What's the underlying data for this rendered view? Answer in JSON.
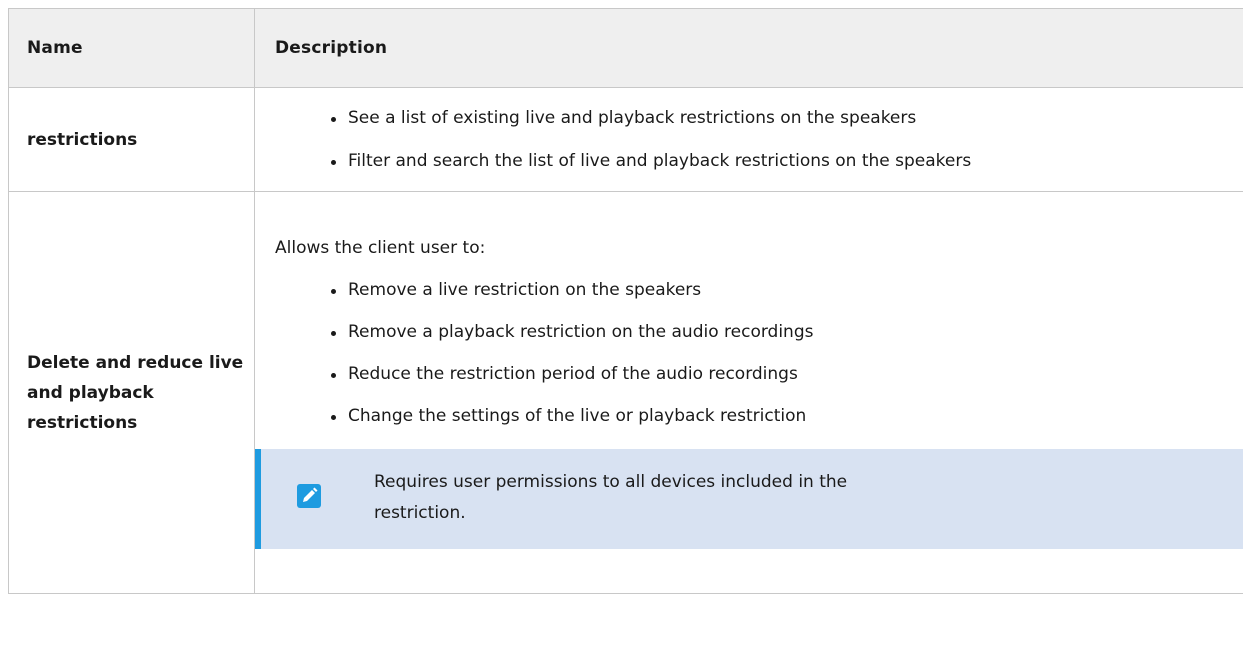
{
  "table": {
    "headers": {
      "name": "Name",
      "description": "Description"
    },
    "rows": [
      {
        "name": "restrictions",
        "intro": "",
        "bullets": [
          "See a list of existing live and playback restrictions on the speakers",
          "Filter and search the list of live and playback restrictions on the speakers"
        ]
      },
      {
        "name": "Delete and reduce live and playback restrictions",
        "intro": "Allows the client user to:",
        "bullets": [
          "Remove a live restriction on the speakers",
          "Remove a playback restriction on the audio recordings",
          "Reduce the restriction period of the audio recordings",
          "Change the settings of the live or playback restriction"
        ],
        "note": {
          "icon": "pencil-icon",
          "text": "Requires user permissions to all devices included in the restriction."
        }
      }
    ]
  },
  "colors": {
    "header_bg": "#efefef",
    "border": "#c8c8c8",
    "note_bg": "#d8e2f2",
    "note_accent": "#1e9be0"
  }
}
